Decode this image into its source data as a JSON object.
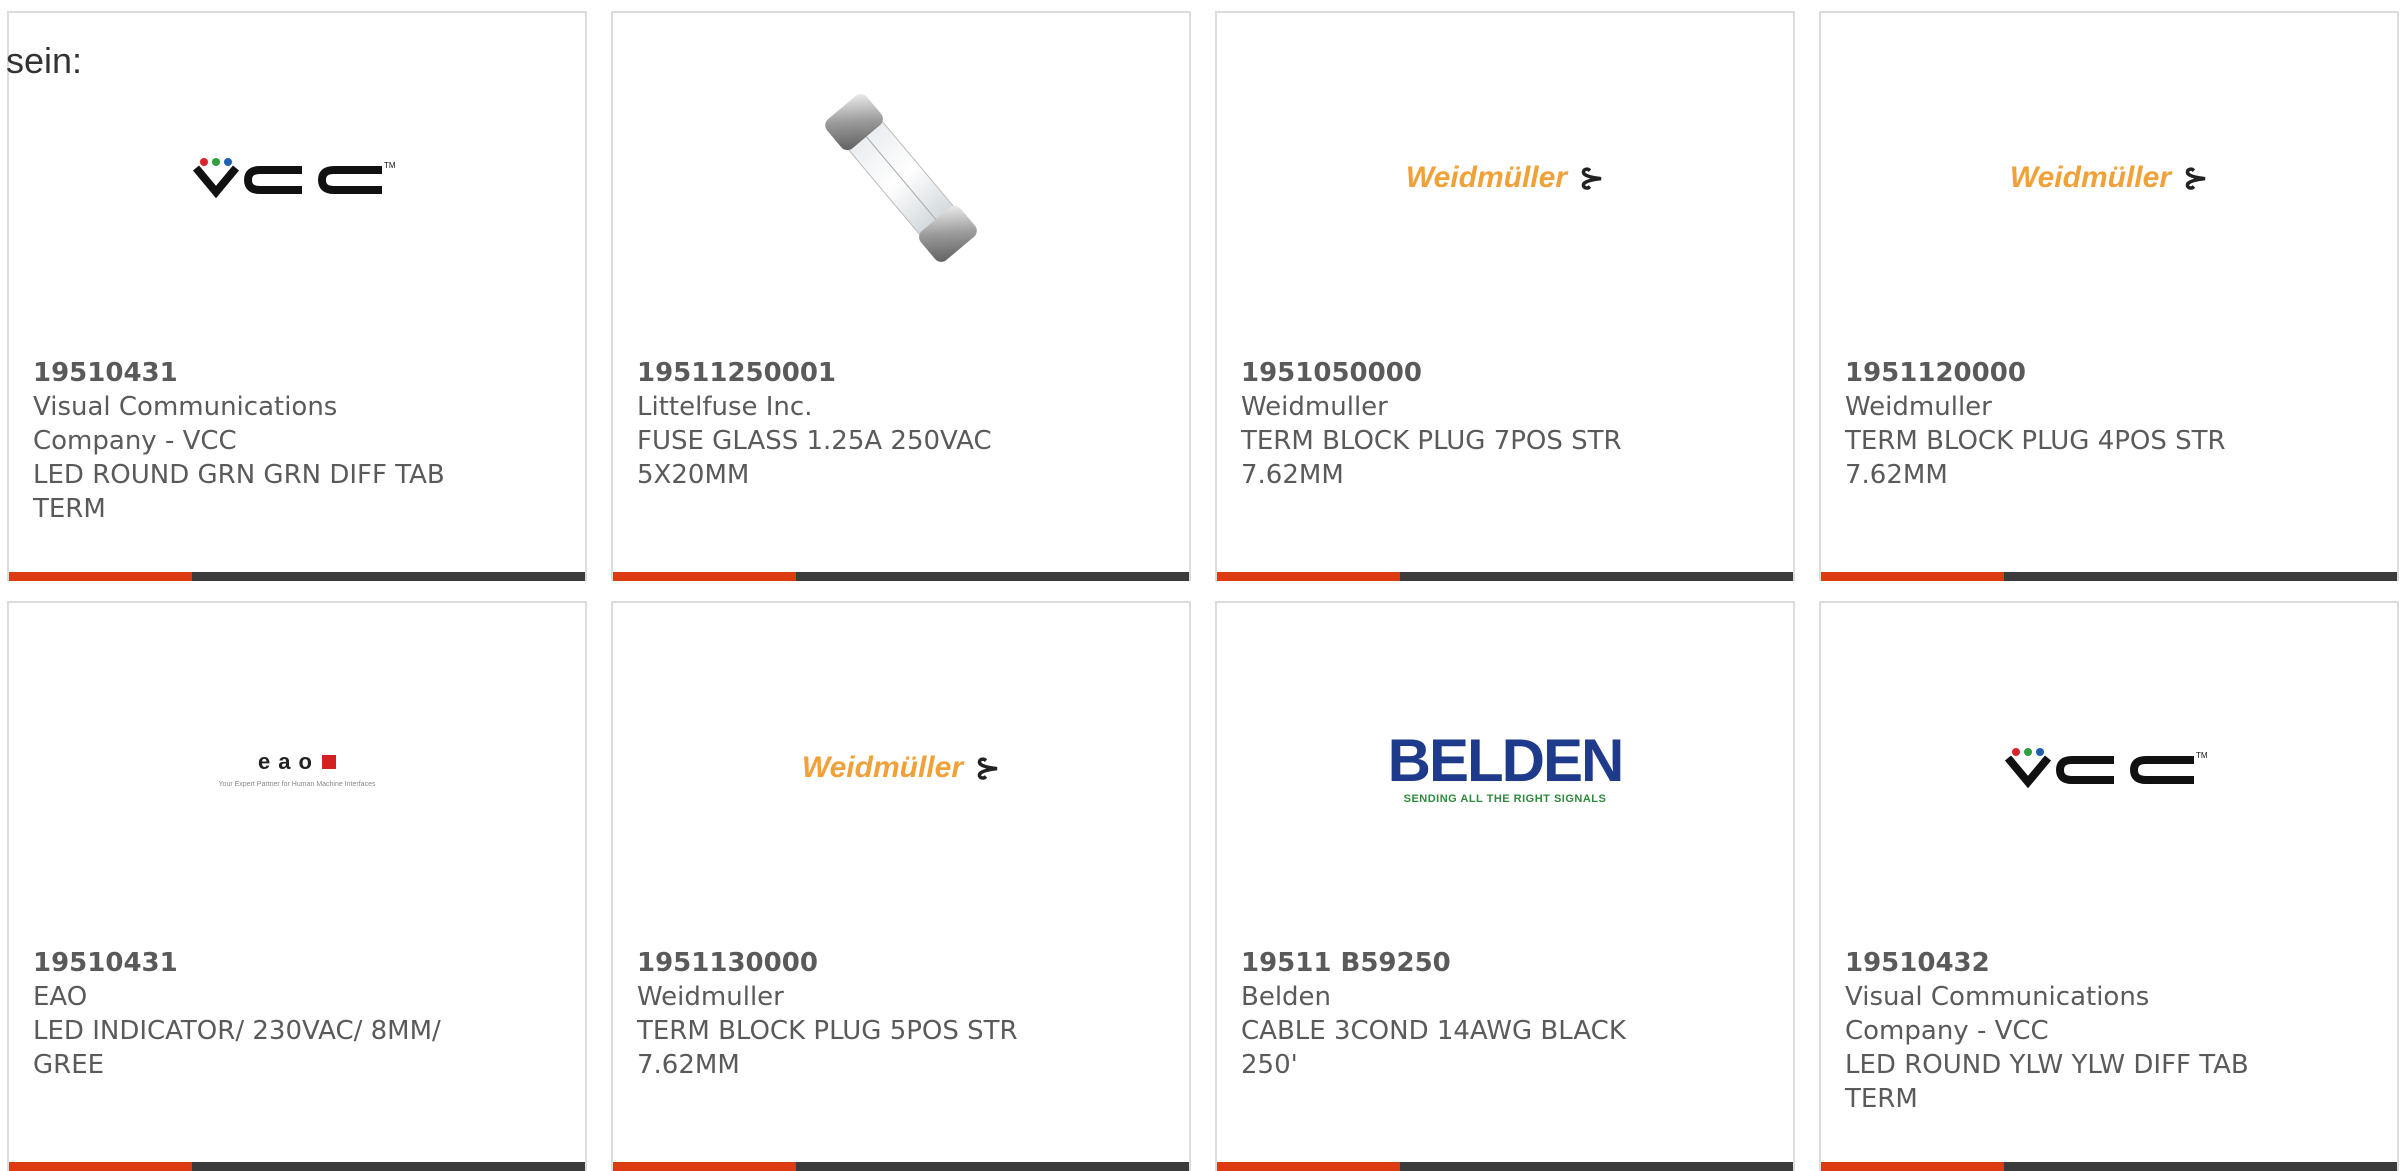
{
  "intro_text": "sein:",
  "brand_colors": {
    "accent": "#dd3c12",
    "bar": "#3b3b3b",
    "weidmuller": "#f0a13a",
    "belden_blue": "#1e3a8a"
  },
  "products": [
    {
      "part_number": "19510431",
      "manufacturer": "Visual Communications Company - VCC",
      "description": "LED ROUND GRN GRN DIFF TAB TERM",
      "logo": "vcc-logo"
    },
    {
      "part_number": "19511250001",
      "manufacturer": "Littelfuse Inc.",
      "description": "FUSE GLASS 1.25A 250VAC 5X20MM",
      "logo": "glass-fuse-image"
    },
    {
      "part_number": "1951050000",
      "manufacturer": "Weidmuller",
      "description": "TERM BLOCK PLUG 7POS STR 7.62MM",
      "logo": "weidmuller-logo"
    },
    {
      "part_number": "1951120000",
      "manufacturer": "Weidmuller",
      "description": "TERM BLOCK PLUG 4POS STR 7.62MM",
      "logo": "weidmuller-logo"
    },
    {
      "part_number": "19510431",
      "manufacturer": "EAO",
      "description": "LED INDICATOR/ 230VAC/ 8MM/ GREE",
      "logo": "eao-logo"
    },
    {
      "part_number": "1951130000",
      "manufacturer": "Weidmuller",
      "description": "TERM BLOCK PLUG 5POS STR 7.62MM",
      "logo": "weidmuller-logo"
    },
    {
      "part_number": "19511 B59250",
      "manufacturer": "Belden",
      "description": "CABLE 3COND 14AWG BLACK 250'",
      "logo": "belden-logo"
    },
    {
      "part_number": "19510432",
      "manufacturer": "Visual Communications Company - VCC",
      "description": "LED ROUND YLW YLW DIFF TAB TERM",
      "logo": "vcc-logo"
    }
  ],
  "logos": {
    "weidmuller_text": "Weidmüller",
    "belden_text": "BELDEN",
    "belden_tagline": "SENDING ALL THE RIGHT SIGNALS",
    "eao_text": "eao",
    "eao_tagline": "Your Expert Partner for Human Machine Interfaces",
    "vcc_text": "VCC"
  }
}
